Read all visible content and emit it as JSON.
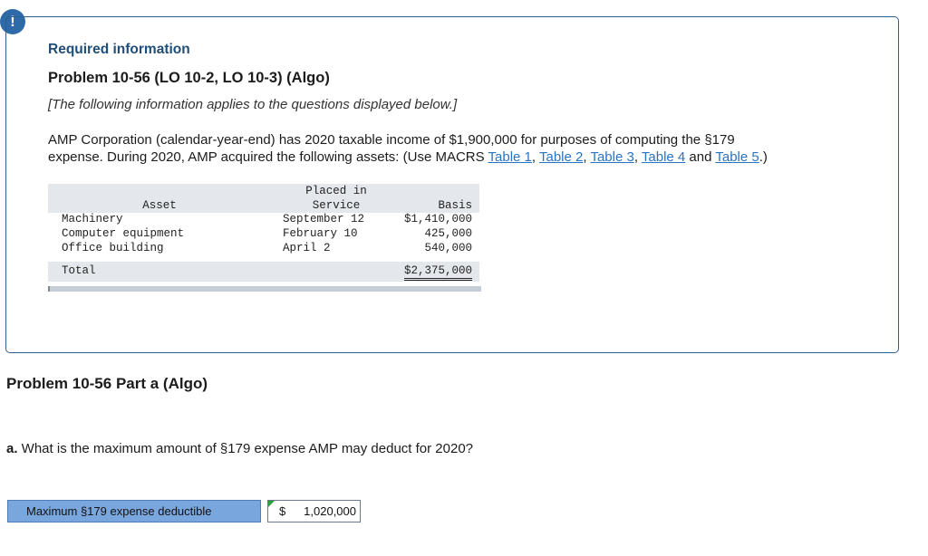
{
  "alert": {
    "symbol": "!"
  },
  "info": {
    "heading": "Required information",
    "problem_title": "Problem 10-56 (LO 10-2, LO 10-3) (Algo)",
    "applies_note": "[The following information applies to the questions displayed below.]",
    "paragraph_line1": "AMP Corporation (calendar-year-end) has 2020 taxable income of $1,900,000 for purposes of computing the §179",
    "paragraph_line2_prefix": "expense. During 2020, AMP acquired the following assets: (Use MACRS ",
    "links": [
      "Table 1",
      "Table 2",
      "Table 3",
      "Table 4",
      "Table 5"
    ],
    "sep_comma": ", ",
    "sep_and": " and ",
    "paragraph_suffix": ".)"
  },
  "asset_table": {
    "headers": {
      "asset": "Asset",
      "placed_line1": "Placed in",
      "placed_line2": "Service",
      "basis": "Basis"
    },
    "rows": [
      {
        "asset": "Machinery",
        "date": "September 12",
        "basis": "$1,410,000"
      },
      {
        "asset": "Computer equipment",
        "date": "February 10",
        "basis": "425,000"
      },
      {
        "asset": "Office building",
        "date": "April 2",
        "basis": "540,000"
      }
    ],
    "total": {
      "label": "Total",
      "basis": "$2,375,000"
    }
  },
  "part_a": {
    "title": "Problem 10-56 Part a (Algo)",
    "question_prefix": "a.",
    "question_text": " What is the maximum amount of §179 expense AMP may deduct for 2020?",
    "answer_label": "Maximum §179 expense deductible",
    "answer_currency": "$",
    "answer_value": "1,020,000"
  }
}
